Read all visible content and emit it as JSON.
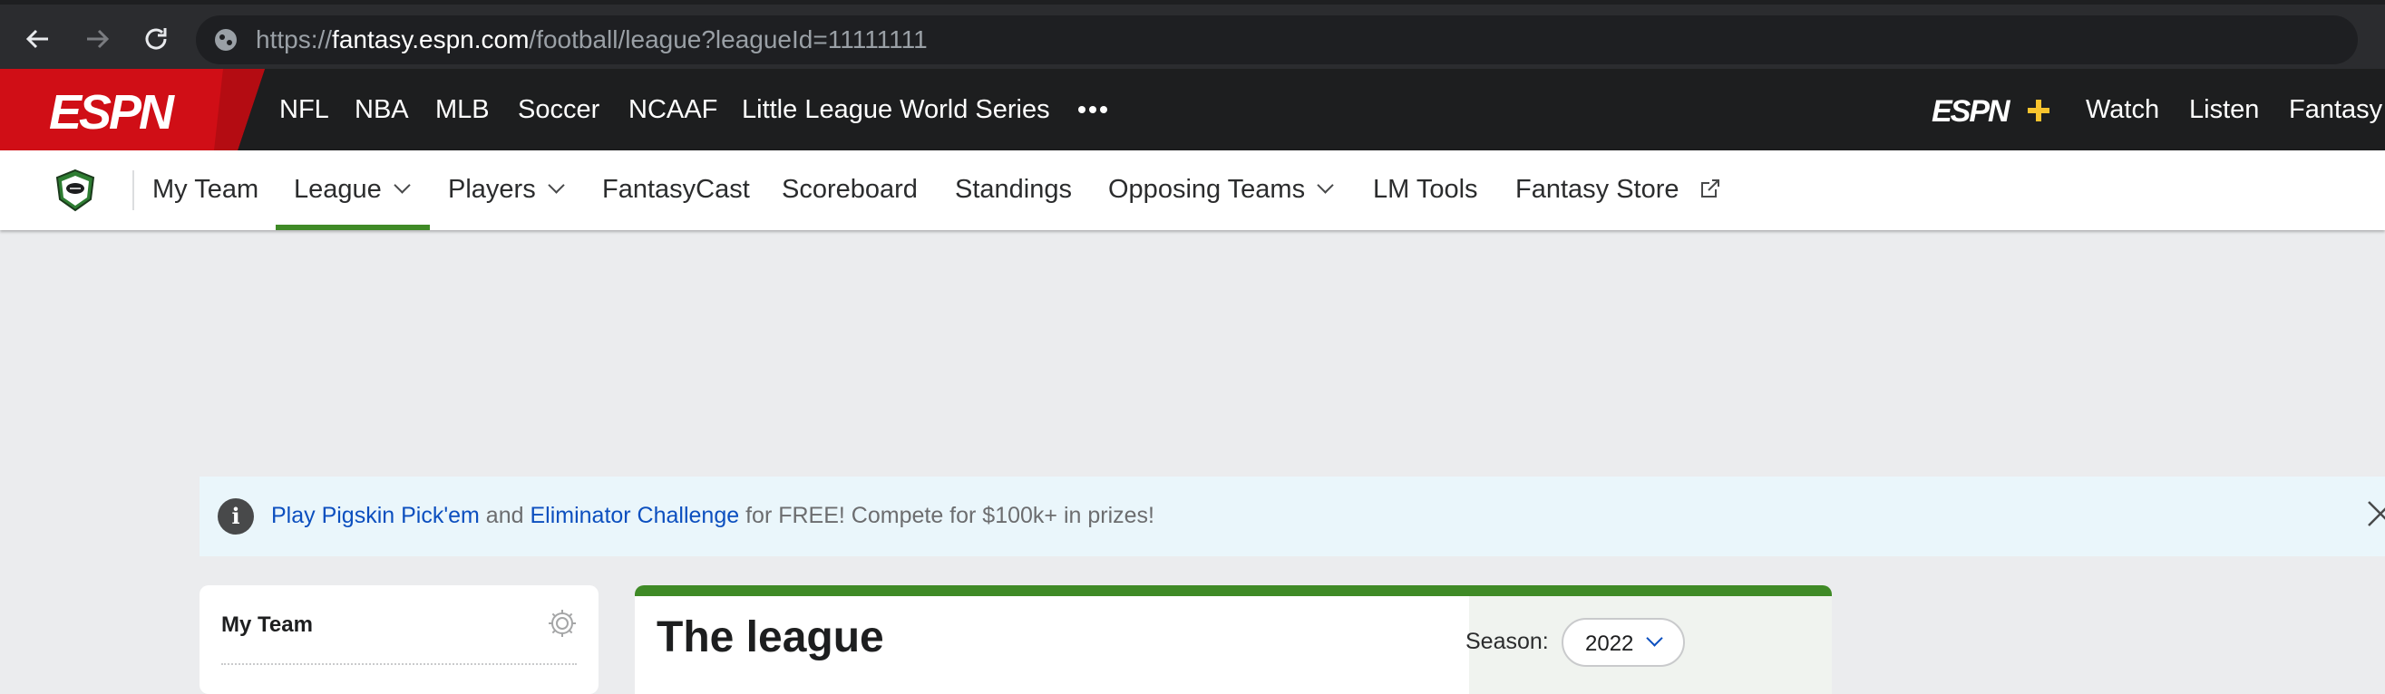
{
  "browser": {
    "url_scheme": "https://",
    "url_host": "fantasy.espn.com",
    "url_path": "/football/league?leagueId=11111111"
  },
  "espn_nav": {
    "logo": "ESPN",
    "sport_links": [
      "NFL",
      "NBA",
      "MLB",
      "Soccer",
      "NCAAF",
      "Little League World Series"
    ],
    "more_icon": "ellipsis-icon",
    "espn_plus_logo": "ESPN+",
    "right_links": [
      "Watch",
      "Listen",
      "Fantasy"
    ]
  },
  "fantasy_nav": {
    "logo_icon": "fantasy-football-shield-icon",
    "items": [
      {
        "label": "My Team"
      },
      {
        "label": "League"
      },
      {
        "label": "Players"
      },
      {
        "label": "FantasyCast"
      },
      {
        "label": "Scoreboard"
      },
      {
        "label": "Standings"
      },
      {
        "label": "Opposing Teams"
      },
      {
        "label": "LM Tools"
      },
      {
        "label": "Fantasy Store"
      }
    ],
    "active_item": "League"
  },
  "banner": {
    "link1": "Play Pigskin Pick'em",
    "text1": " and ",
    "link2": "Eliminator Challenge",
    "text2": " for FREE! Compete for $100k+ in prizes!"
  },
  "my_team_card": {
    "title": "My Team"
  },
  "league_card": {
    "title": "The league",
    "season_label": "Season:",
    "season_value": "2022"
  },
  "colors": {
    "espn_red": "#d00e16",
    "active_green": "#3f8a26",
    "link_blue": "#0c4fbf",
    "espn_plus_yellow": "#f7c32e"
  }
}
